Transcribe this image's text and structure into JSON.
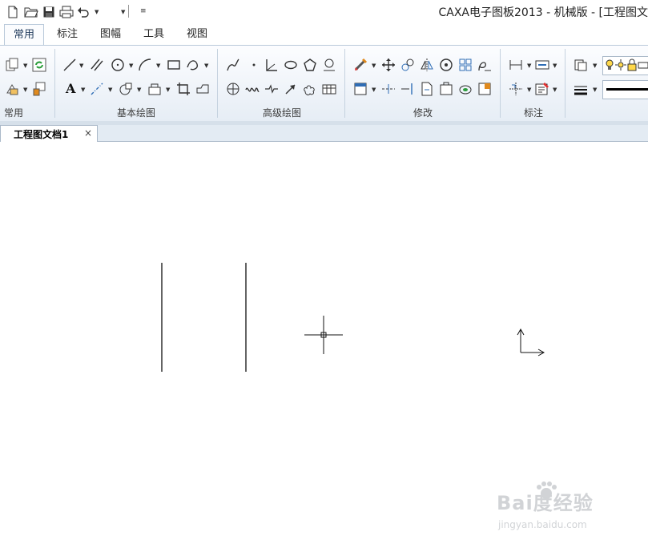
{
  "app": {
    "title": "CAXA电子图板2013 - 机械版 - [工程图文"
  },
  "tabs": [
    {
      "label": "常用",
      "active": true
    },
    {
      "label": "标注"
    },
    {
      "label": "图幅"
    },
    {
      "label": "工具"
    },
    {
      "label": "视图"
    }
  ],
  "groups": {
    "common": "常用",
    "basic_draw": "基本绘图",
    "advanced_draw": "高级绘图",
    "modify": "修改",
    "annotate": "标注"
  },
  "document_tab": {
    "label": "工程图文档1",
    "close": "×"
  },
  "watermark": {
    "text": "Bai度经验",
    "url": "jingyan.baidu.com"
  },
  "colors": {
    "accent": "#1e395b",
    "ribbon_border": "#b9c9da",
    "tab_active_text": "#1e395b",
    "icon_blue": "#2f6db5",
    "icon_orange": "#e08a1e"
  },
  "icons": [
    "new-file-icon",
    "open-folder-icon",
    "save-icon",
    "print-icon",
    "undo-icon",
    "line-icon",
    "parallel-line-icon",
    "circle-icon",
    "arc-icon",
    "rectangle-icon",
    "spline-icon",
    "text-icon",
    "centerline-icon",
    "hatch-icon",
    "block-icon",
    "polyline-icon",
    "point-icon",
    "angle-line-icon",
    "ellipse-icon",
    "polygon-icon",
    "delete-icon",
    "move-icon",
    "copy-icon",
    "mirror-icon",
    "rotate-icon",
    "array-icon",
    "trim-icon",
    "dimension-icon",
    "layer-icon",
    "linetype-icon",
    "crosshair-cursor-icon",
    "ucs-axis-icon"
  ]
}
